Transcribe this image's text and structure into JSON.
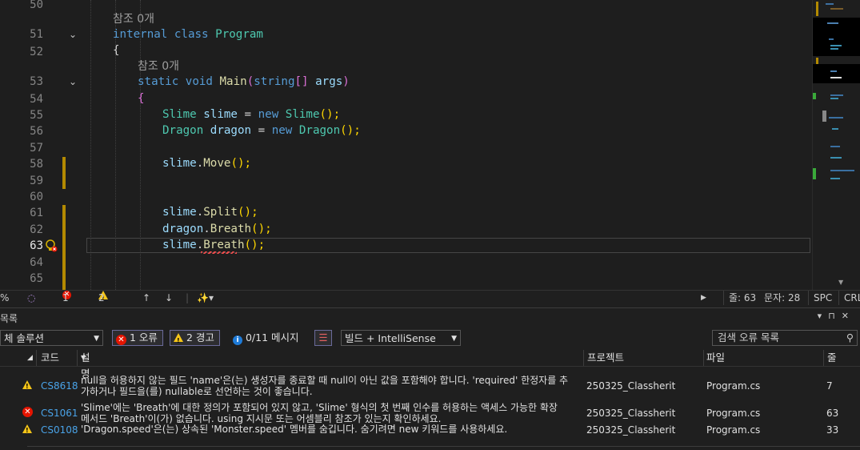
{
  "editor": {
    "refs_label": "참조 0개",
    "lines": [
      {
        "n": "50"
      },
      {
        "n": "51"
      },
      {
        "n": "52"
      },
      {
        "n": "53"
      },
      {
        "n": "54"
      },
      {
        "n": "55"
      },
      {
        "n": "56"
      },
      {
        "n": "57"
      },
      {
        "n": "58"
      },
      {
        "n": "59"
      },
      {
        "n": "60"
      },
      {
        "n": "61"
      },
      {
        "n": "62"
      },
      {
        "n": "63"
      },
      {
        "n": "64"
      },
      {
        "n": "65"
      }
    ],
    "tokens": {
      "internal": "internal",
      "class": "class",
      "program": "Program",
      "open_brace": "{",
      "static": "static",
      "void": "void",
      "main": "Main",
      "paren_open": "(",
      "string": "string",
      "brackets": "[]",
      "args": "args",
      "paren_close": ")",
      "slime_type": "Slime",
      "slime_var": "slime",
      "eq": "=",
      "new": "new",
      "call_end": "();",
      "dragon_type": "Dragon",
      "dragon_var": "dragon",
      "move": "Move",
      "split": "Split",
      "breath": "Breath",
      "dot": "."
    }
  },
  "status": {
    "zoom": "%",
    "errors": "1",
    "warnings": "2",
    "line": "줄: 63",
    "col": "문자: 28",
    "spc": "SPC",
    "crlf": "CRL"
  },
  "panel": {
    "title": "목록",
    "scope": "체 솔루션",
    "errors_btn": "1 오류",
    "warnings_btn": "2 경고",
    "messages_btn": "0/11 메시지",
    "build_filter": "빌드 + IntelliSense",
    "search_placeholder": "검색 오류 목록",
    "columns": {
      "code": "코드",
      "desc": "설명",
      "project": "프로젝트",
      "file": "파일",
      "line": "줄"
    },
    "rows": [
      {
        "severity": "warning",
        "code": "CS8618",
        "desc1": "null을 허용하지 않는 필드 'name'은(는) 생성자를 종료할 때 null이 아닌 값을 포함해야 합니다. 'required' 한정자를 추",
        "desc2": "가하거나 필드을(를) nullable로 선언하는 것이 좋습니다.",
        "project": "250325_Classherit",
        "file": "Program.cs",
        "line": "7"
      },
      {
        "severity": "error",
        "code": "CS1061",
        "desc1": "'Slime'에는 'Breath'에 대한 정의가 포함되어 있지 않고, 'Slime' 형식의 첫 번째 인수를 허용하는 액세스 가능한 확장",
        "desc2": "메서드 'Breath'이(가) 없습니다. using 지시문 또는 어셈블리 참조가 있는지 확인하세요.",
        "project": "250325_Classherit",
        "file": "Program.cs",
        "line": "63"
      },
      {
        "severity": "warning",
        "code": "CS0108",
        "desc1": "'Dragon.speed'은(는) 상속된 'Monster.speed' 멤버를 숨깁니다. 숨기려면 new 키워드를 사용하세요.",
        "desc2": "",
        "project": "250325_Classherit",
        "file": "Program.cs",
        "line": "33"
      }
    ]
  },
  "colors": {
    "error": "#e51400",
    "warning": "#f5c518",
    "link": "#4aa3e8",
    "accent": "#6a6a9a"
  }
}
